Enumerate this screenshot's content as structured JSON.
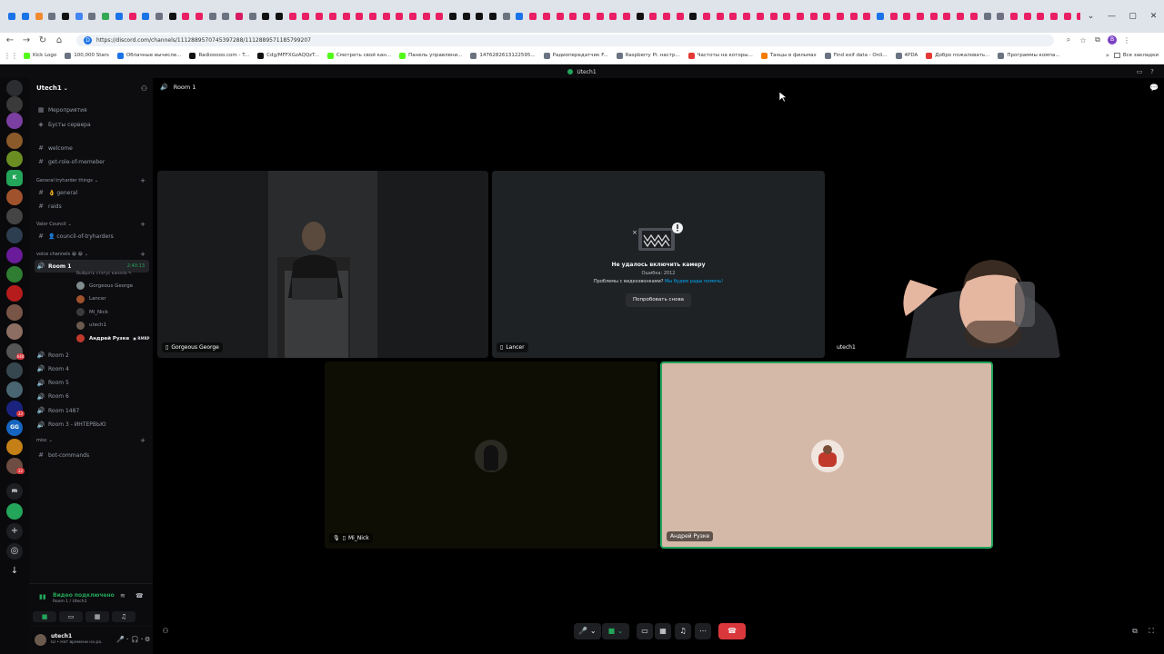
{
  "browser": {
    "tab_colors": [
      "#1a73e8",
      "#1a73e8",
      "#f28b30",
      "#6b7280",
      "#111111",
      "#4285f4",
      "#6b7280",
      "#34a853",
      "#1a73e8",
      "#e91e63",
      "#1a73e8",
      "#6b7280",
      "#111111",
      "#e91e63",
      "#e91e63",
      "#6b7280",
      "#6b7280",
      "#d81b60",
      "#6b7280",
      "#111111",
      "#111111",
      "#e91e63",
      "#e91e63",
      "#e91e63",
      "#e91e63",
      "#e91e63",
      "#e91e63",
      "#e91e63",
      "#e91e63",
      "#e91e63",
      "#e91e63",
      "#e91e63",
      "#e91e63",
      "#111111",
      "#111111",
      "#111111",
      "#111111",
      "#6b7280",
      "#1a73e8",
      "#e91e63",
      "#e91e63",
      "#e91e63",
      "#e91e63",
      "#e91e63",
      "#e91e63",
      "#e91e63",
      "#e91e63",
      "#111111",
      "#e91e63",
      "#e91e63",
      "#e91e63",
      "#111111",
      "#e91e63",
      "#e91e63",
      "#e91e63",
      "#e91e63",
      "#e91e63",
      "#e91e63",
      "#e91e63",
      "#e91e63",
      "#e91e63",
      "#e91e63",
      "#e91e63",
      "#e91e63",
      "#e91e63",
      "#1a73e8",
      "#e91e63",
      "#e91e63",
      "#e91e63",
      "#e91e63",
      "#e91e63",
      "#e91e63",
      "#e91e63",
      "#6b7280",
      "#6b7280",
      "#e91e63",
      "#e91e63",
      "#e91e63",
      "#e91e63",
      "#e91e63",
      "#e91e63",
      "#e91e63",
      "#e91e63",
      "#e91e63",
      "#e91e63",
      "#e91e63",
      "#4285f4",
      "#e91e63",
      "#4285f4",
      "#e91e63",
      "#e91e63"
    ],
    "tab_close": "×",
    "new_tab": "+",
    "window_controls": [
      "⌄",
      "—",
      "▢",
      "✕"
    ],
    "nav": {
      "back": "←",
      "forward": "→",
      "reload": "↻",
      "home": "⌂"
    },
    "url": "https://discord.com/channels/1112889570745397288/1112889571185799207",
    "site_icon": "D",
    "addr_icons": {
      "zoom": "⌕",
      "star": "☆",
      "extensions": "⧉",
      "menu": "⋮"
    },
    "profile_initial": "B",
    "bookmarks": [
      {
        "label": "Kick Logo",
        "color": "#53fc18"
      },
      {
        "label": "100,000 Stars",
        "color": "#6b7280"
      },
      {
        "label": "Облачные вычисле...",
        "color": "#1a73e8"
      },
      {
        "label": "Radiooooo.com - T...",
        "color": "#111111"
      },
      {
        "label": "Cdg/MFFXGzAQQzT...",
        "color": "#111111"
      },
      {
        "label": "Смотреть свой кан...",
        "color": "#53fc18"
      },
      {
        "label": "Панель управлени...",
        "color": "#53fc18"
      },
      {
        "label": "1476282613122595...",
        "color": "#6b7280"
      },
      {
        "label": "Радиопередатчик F...",
        "color": "#6b7280"
      },
      {
        "label": "Raspberry Pi: настр...",
        "color": "#6b7280"
      },
      {
        "label": "Частоты на которы...",
        "color": "#e53935"
      },
      {
        "label": "Танцы в фильмах",
        "color": "#f57c00"
      },
      {
        "label": "Find exif data - Onli...",
        "color": "#6b7280"
      },
      {
        "label": "4PDA",
        "color": "#6b7280"
      },
      {
        "label": "Добро пожаловать...",
        "color": "#e53935"
      },
      {
        "label": "Программы компа...",
        "color": "#6b7280"
      }
    ],
    "bookmarks_more": "»",
    "all_bookmarks": "Все закладки"
  },
  "discord": {
    "window_title": "Utech1",
    "server": {
      "name": "Utech1",
      "chevron": "⌄"
    },
    "guild_badges": [
      "640",
      "23",
      "22"
    ],
    "sidebar_top": [
      {
        "icon": "▦",
        "label": "Мероприятия"
      },
      {
        "icon": "◈",
        "label": "Бусты сервера"
      }
    ],
    "text_channels": [
      "welcome",
      "get-role-of-memeber"
    ],
    "categories": {
      "general": "General tryharder things",
      "valor": "Valor Council",
      "voice": "voice channels 😀 😀",
      "misc": "misc"
    },
    "general_channels": [
      "👌 general",
      "raids"
    ],
    "valor_channels": [
      "👤 council-of-tryharders"
    ],
    "active_room": {
      "name": "Room 1",
      "time": "2:40:13",
      "status": "Выбрать статус канала"
    },
    "room1_users": [
      {
        "name": "Gorgeous George",
        "color": "#7f8c8d",
        "icon": "▭",
        "bold": false
      },
      {
        "name": "Lancer",
        "color": "#a0522d",
        "icon": "▭",
        "bold": false
      },
      {
        "name": "Mi_Nick",
        "color": "#3b3b3b",
        "icon": "🎙",
        "bold": false
      },
      {
        "name": "utech1",
        "color": "#6b5b4e",
        "icon": "",
        "bold": false
      },
      {
        "name": "Андрей Рузке",
        "color": "#c0392b",
        "icon": "",
        "bold": true,
        "tag": "▣ RMRP"
      }
    ],
    "voice_rooms": [
      "Room 2",
      "Room 4",
      "Room 5",
      "Room 6",
      "Room 1487",
      "Room 3 - ИНТЕРВЬЮ"
    ],
    "misc_channels": [
      "bot-commands"
    ],
    "voice_panel": {
      "title": "Видео подключено",
      "sub": "Room 1 / Utech1"
    },
    "user": {
      "name": "utech1",
      "status": "ID • Нет времени на ра..."
    },
    "room_title": "Room 1",
    "tiles": {
      "george": "Gorgeous George",
      "lancer": "Lancer",
      "utech": "utech1",
      "minick": "Mi_Nick",
      "andrey": "Андрей Рузке"
    },
    "camera_error": {
      "title": "Не удалось включить камеру",
      "code": "Ошибка: 2012",
      "question": "Проблемы с видеозвонками?",
      "link": "Мы будем рады помочь!",
      "retry": "Попробовать снова"
    }
  }
}
